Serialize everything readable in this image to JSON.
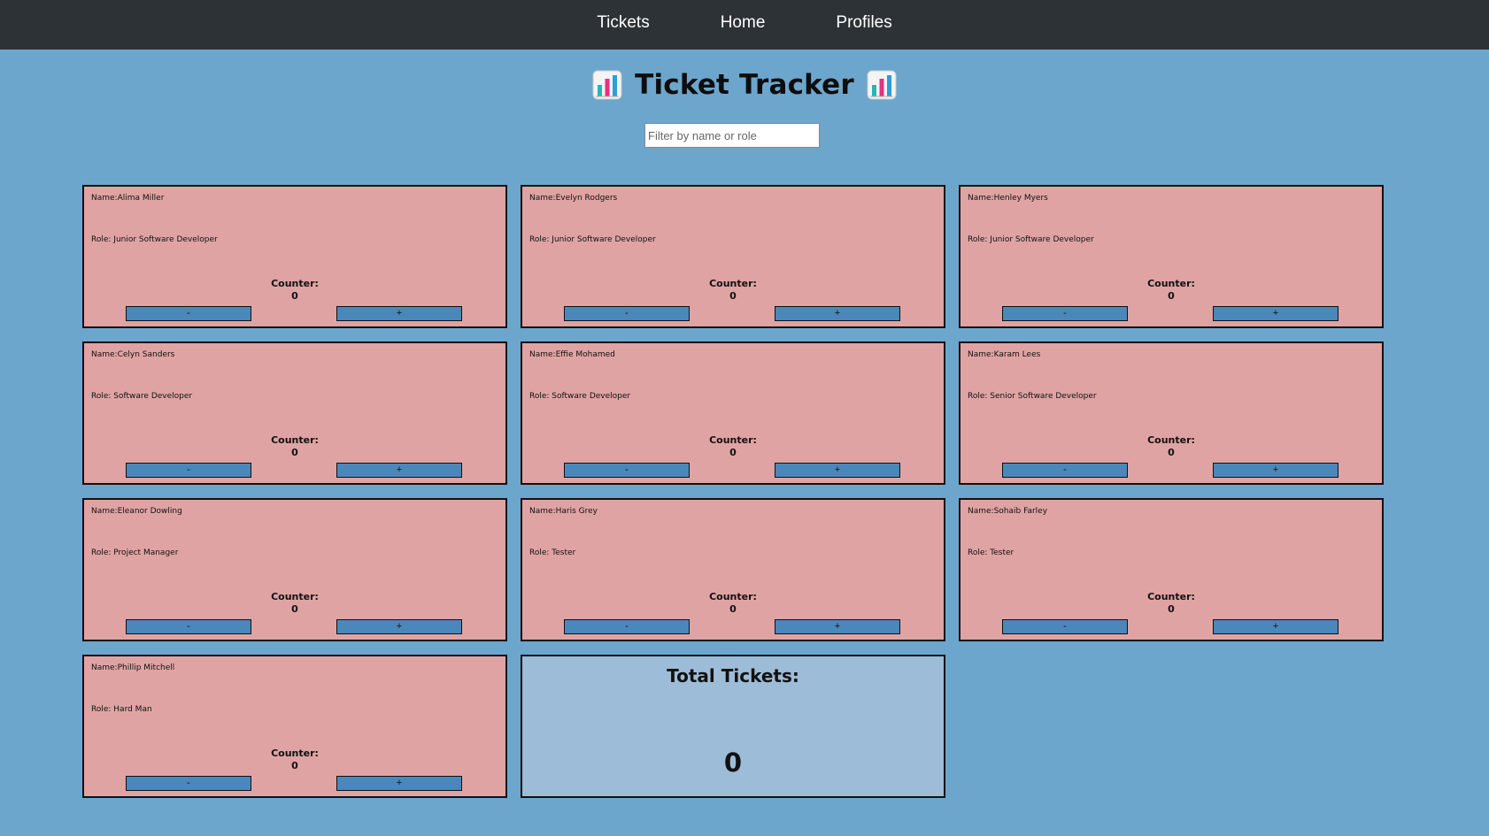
{
  "nav": {
    "items": [
      "Tickets",
      "Home",
      "Profiles"
    ]
  },
  "header": {
    "title": "Ticket Tracker",
    "icon": "bar-chart-icon"
  },
  "filter": {
    "placeholder": "Filter by name or role",
    "value": ""
  },
  "card_labels": {
    "counter_label": "Counter:",
    "minus_label": "-",
    "plus_label": "+"
  },
  "people": [
    {
      "name": "Name:Alima Miller",
      "role": "Role: Junior Software Developer",
      "counter": "0"
    },
    {
      "name": "Name:Evelyn Rodgers",
      "role": "Role: Junior Software Developer",
      "counter": "0"
    },
    {
      "name": "Name:Henley Myers",
      "role": "Role: Junior Software Developer",
      "counter": "0"
    },
    {
      "name": "Name:Celyn Sanders",
      "role": "Role: Software Developer",
      "counter": "0"
    },
    {
      "name": "Name:Effie Mohamed",
      "role": "Role: Software Developer",
      "counter": "0"
    },
    {
      "name": "Name:Karam Lees",
      "role": "Role: Senior Software Developer",
      "counter": "0"
    },
    {
      "name": "Name:Eleanor Dowling",
      "role": "Role: Project Manager",
      "counter": "0"
    },
    {
      "name": "Name:Haris Grey",
      "role": "Role: Tester",
      "counter": "0"
    },
    {
      "name": "Name:Sohaib Farley",
      "role": "Role: Tester",
      "counter": "0"
    },
    {
      "name": "Name:Phillip Mitchell",
      "role": "Role: Hard Man",
      "counter": "0"
    }
  ],
  "total": {
    "label": "Total Tickets:",
    "value": "0"
  },
  "colors": {
    "background": "#6ca6cd",
    "navbar": "#2d3236",
    "card": "#e0a3a3",
    "button": "#4a87bb",
    "total_card": "#9dbcd8"
  }
}
